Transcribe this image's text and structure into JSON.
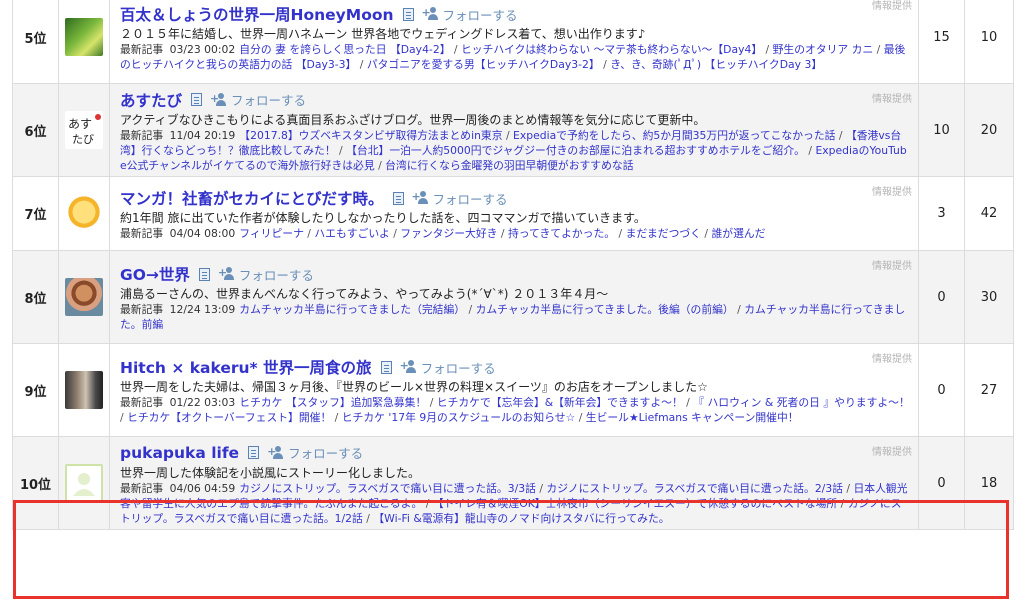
{
  "recent_label": "最新記事",
  "follow_label": "フォローする",
  "info_label": "情報提供",
  "rows": [
    {
      "rank": "5位",
      "title": "百太＆しょうの世界一周HoneyMoon",
      "desc": "２０１５年に結婚し、世界一周ハネムーン 世界各地でウェディングドレス着て、想い出作ります♪",
      "date": "03/23 00:02",
      "articles": [
        "自分の 妻 を誇らしく思った日 【Day4-2】",
        "ヒッチハイクは終わらない 〜マテ茶も終わらない〜【Day4】",
        "野生のオタリア カニ",
        "最後のヒッチハイクと我らの英語力の話 【Day3-3】",
        "パタゴニアを愛する男【ヒッチハイクDay3-2】",
        "き、き、奇跡(ﾟДﾟ) 【ヒッチハイクDay 3】"
      ],
      "out": "15",
      "in": "10"
    },
    {
      "rank": "6位",
      "title": "あすたび",
      "desc": "アクティブなひきこもりによる真面目系おふざけブログ。世界一周後のまとめ情報等を気分に応じて更新中。",
      "date": "11/04 20:19",
      "articles": [
        "【2017.8】ウズベキスタンビザ取得方法まとめin東京",
        "Expediaで予約をしたら、約5か月間35万円が返ってこなかった話",
        "【香港vs台湾】行くならどっち！？徹底比較してみた！",
        "【台北】一泊一人約5000円でジャグジー付きのお部屋に泊まれる超おすすめホテルをご紹介。",
        "ExpediaのYouTube公式チャンネルがイケてるので海外旅行好きは必見",
        "台湾に行くなら金曜発の羽田早朝便がおすすめな話"
      ],
      "out": "10",
      "in": "20"
    },
    {
      "rank": "7位",
      "title": "マンガ！社畜がセカイにとびだす時。",
      "desc": "約1年間 旅に出ていた作者が体験したりしなかったりした話を、四コママンガで描いていきます。",
      "date": "04/04 08:00",
      "articles": [
        "フィリピーナ",
        "ハエもすごいよ",
        "ファンタジー大好き",
        "持ってきてよかった。",
        "まだまだつづく",
        "誰が選んだ"
      ],
      "out": "3",
      "in": "42"
    },
    {
      "rank": "8位",
      "title": "GO→世界",
      "desc": "浦島るーさんの、世界まんべんなく行ってみよう、やってみよう(*´∀`*) ２０１３年４月〜",
      "date": "12/24 13:09",
      "articles": [
        "カムチャッカ半島に行ってきました（完結編）",
        "カムチャッカ半島に行ってきました。後編（の前編）",
        "カムチャッカ半島に行ってきました。前編"
      ],
      "out": "0",
      "in": "30"
    },
    {
      "rank": "9位",
      "title": "Hitch × kakeru* 世界一周食の旅",
      "desc": "世界一周をした夫婦は、帰国３ヶ月後、『世界のビール×世界の料理×スイーツ』のお店をオープンしました☆",
      "date": "01/22 03:03",
      "articles": [
        "ヒチカケ 【スタッフ】追加緊急募集！",
        "ヒチカケで【忘年会】&【新年会】できますよ〜！",
        "『 ハロウィン & 死者の日 』やりますよ〜！",
        "ヒチカケ【オクトーバーフェスト】開催！",
        "ヒチカケ '17年 9月のスケジュールのお知らせ☆",
        "生ビール★Liefmans キャンペーン開催中！"
      ],
      "out": "0",
      "in": "27"
    },
    {
      "rank": "10位",
      "title": "pukapuka life",
      "desc": "世界一周した体験記を小説風にストーリー化しました。",
      "date": "04/06 04:59",
      "articles": [
        "カジノにストリップ。ラスベガスで痛い目に遭った話。3/3話",
        "カジノにストリップ。ラスベガスで痛い目に遭った話。2/3話",
        "日本人観光客や留学生に人気のエプ島で銃撃事件。たぶんまた起こるよ。",
        "【トイレ有＆喫煙OK】士林夜市（シーリンイエスー）で休憩するのにベストな場所",
        "カジノにストリップ。ラスベガスで痛い目に遭った話。1/2話",
        "【Wi-Fi &電源有】龍山寺のノマド向けスタバに行ってみた。"
      ],
      "out": "0",
      "in": "18"
    }
  ]
}
